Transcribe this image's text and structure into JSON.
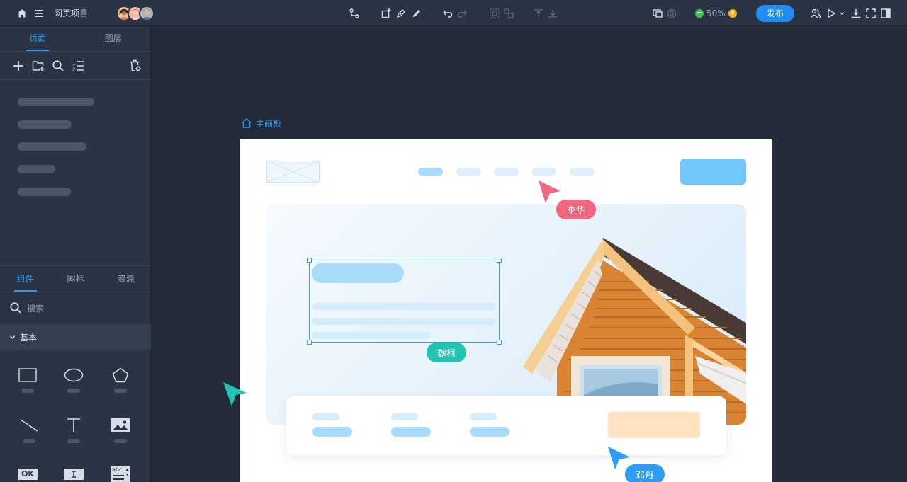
{
  "app": {
    "project_title": "网页项目",
    "zoom_label": "50%",
    "publish_label": "发布"
  },
  "sidebar": {
    "top_tabs": [
      {
        "label": "页面",
        "active": true
      },
      {
        "label": "图层",
        "active": false
      }
    ],
    "page_tools": [
      "add-icon",
      "add-folder-icon",
      "search-icon",
      "sort-list-icon",
      "delete-settings-icon"
    ],
    "pages_count": 5,
    "bottom_tabs": [
      {
        "label": "组件",
        "active": true
      },
      {
        "label": "图标",
        "active": false
      },
      {
        "label": "资源",
        "active": false
      }
    ],
    "search_placeholder": "搜索",
    "group_label": "基本",
    "components": [
      "rectangle-icon",
      "ellipse-icon",
      "pentagon-icon",
      "line-icon",
      "text-icon",
      "image-icon",
      "button-icon",
      "input-icon",
      "select-icon"
    ],
    "button_component_text": "OK",
    "select_component_text": "abc"
  },
  "canvas": {
    "breadcrumb_label": "主画板",
    "collaborators": [
      {
        "name": "李华",
        "color": "#f2677f"
      },
      {
        "name": "魏柯",
        "color": "#22c3b0"
      },
      {
        "name": "邓丹",
        "color": "#2e9cf2"
      }
    ]
  },
  "colors": {
    "accent": "#1e8ff0",
    "topbar": "#2b3444",
    "canvas_bg": "#232a38",
    "placeholder_blue": "#a9dcfb",
    "placeholder_orange": "#ffe2c2"
  }
}
